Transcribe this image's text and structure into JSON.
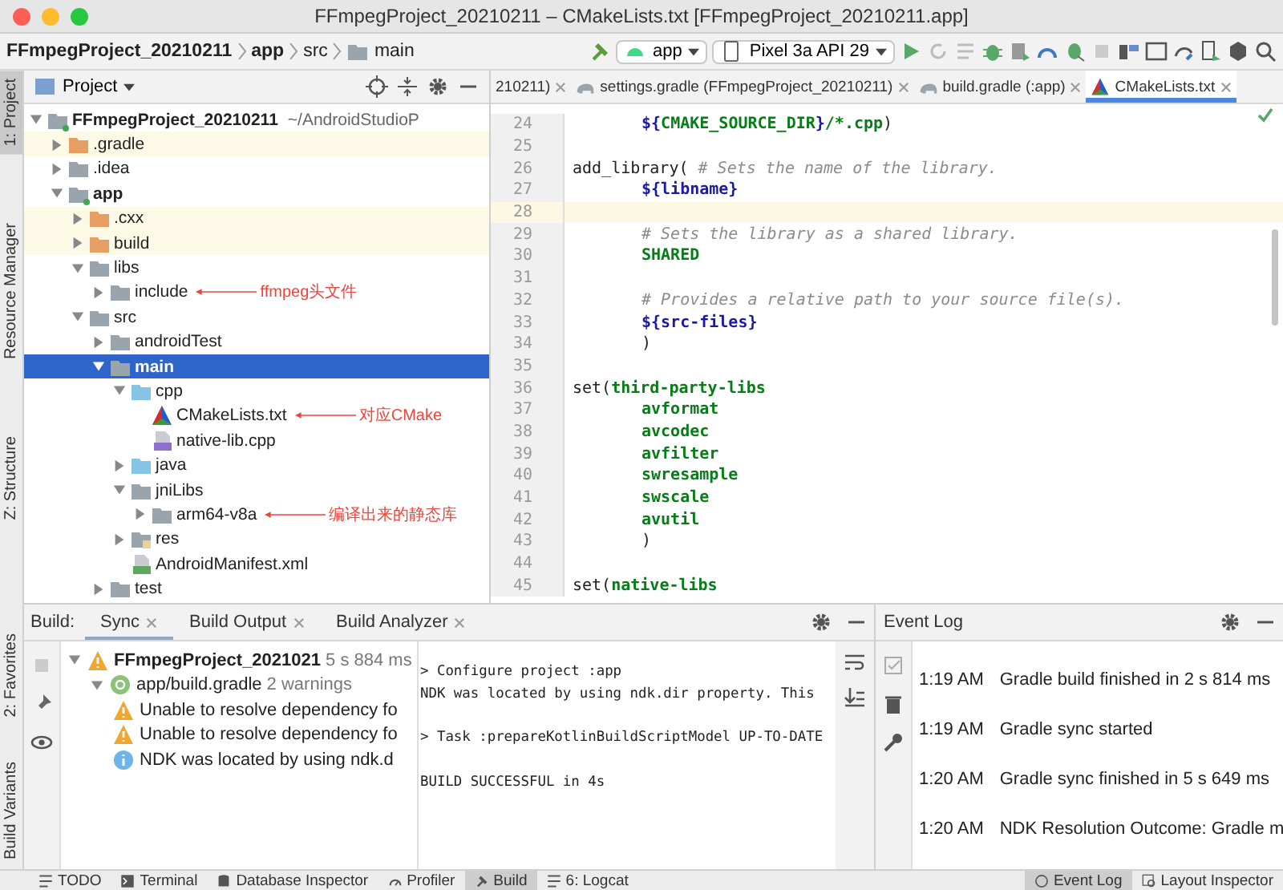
{
  "window": {
    "title": "FFmpegProject_20210211 – CMakeLists.txt [FFmpegProject_20210211.app]"
  },
  "breadcrumbs": [
    {
      "label": "FFmpegProject_20210211",
      "bold": true
    },
    {
      "label": "app",
      "bold": true
    },
    {
      "label": "src",
      "bold": false
    },
    {
      "label": "main",
      "bold": false
    }
  ],
  "run_config": {
    "label": "app"
  },
  "device": {
    "label": "Pixel 3a API 29"
  },
  "left_strip_top": [
    {
      "label": "1: Project",
      "selected": true
    },
    {
      "label": "Resource Manager",
      "selected": false
    },
    {
      "label": "Z: Structure",
      "selected": false
    }
  ],
  "left_strip_bottom": [
    {
      "label": "2: Favorites",
      "selected": false
    },
    {
      "label": "Build Variants",
      "selected": false
    }
  ],
  "project_panel": {
    "title": "Project",
    "tree": [
      {
        "label": "FFmpegProject_20210211",
        "path": "~/AndroidStudioP",
        "kind": "module",
        "bold": true,
        "expanded": true,
        "selected": false,
        "children": [
          {
            "label": ".gradle",
            "kind": "excluded",
            "expanded": false,
            "selected": false
          },
          {
            "label": ".idea",
            "kind": "folder",
            "expanded": false,
            "selected": false
          },
          {
            "label": "app",
            "kind": "module",
            "bold": true,
            "expanded": true,
            "selected": false,
            "children": [
              {
                "label": ".cxx",
                "kind": "excluded",
                "expanded": false,
                "selected": false
              },
              {
                "label": "build",
                "kind": "excluded",
                "expanded": false,
                "selected": false
              },
              {
                "label": "libs",
                "kind": "folder",
                "expanded": true,
                "selected": false,
                "children": [
                  {
                    "label": "include",
                    "kind": "folder",
                    "expanded": false,
                    "selected": false,
                    "note": "ffmpeg头文件"
                  }
                ]
              },
              {
                "label": "src",
                "kind": "folder",
                "expanded": true,
                "selected": false,
                "children": [
                  {
                    "label": "androidTest",
                    "kind": "folder",
                    "expanded": false,
                    "selected": false
                  },
                  {
                    "label": "main",
                    "kind": "folder",
                    "bold": true,
                    "expanded": true,
                    "selected": true,
                    "children": [
                      {
                        "label": "cpp",
                        "kind": "source",
                        "expanded": true,
                        "selected": false,
                        "children": [
                          {
                            "label": "CMakeLists.txt",
                            "kind": "cmake",
                            "selected": false,
                            "note": "对应CMake"
                          },
                          {
                            "label": "native-lib.cpp",
                            "kind": "cpp",
                            "selected": false
                          }
                        ]
                      },
                      {
                        "label": "java",
                        "kind": "source",
                        "expanded": false,
                        "selected": false
                      },
                      {
                        "label": "jniLibs",
                        "kind": "folder",
                        "expanded": true,
                        "selected": false,
                        "children": [
                          {
                            "label": "arm64-v8a",
                            "kind": "folder",
                            "expanded": false,
                            "selected": false,
                            "note": "编译出来的静态库"
                          }
                        ]
                      },
                      {
                        "label": "res",
                        "kind": "resources",
                        "expanded": false,
                        "selected": false
                      },
                      {
                        "label": "AndroidManifest.xml",
                        "kind": "manifest",
                        "selected": false
                      }
                    ]
                  },
                  {
                    "label": "test",
                    "kind": "folder",
                    "expanded": false,
                    "selected": false
                  }
                ]
              }
            ]
          }
        ]
      }
    ]
  },
  "editor_tabs": [
    {
      "label": "210211)",
      "kind": "text",
      "selected": false
    },
    {
      "label": "settings.gradle (FFmpegProject_20210211)",
      "kind": "gradle",
      "selected": false
    },
    {
      "label": "build.gradle (:app)",
      "kind": "gradle",
      "selected": false
    },
    {
      "label": "CMakeLists.txt",
      "kind": "cmake",
      "selected": true
    }
  ],
  "code_lines": [
    {
      "number": "24",
      "indented": true,
      "current": false,
      "segments": [
        {
          "text": "${",
          "kind": "var"
        },
        {
          "text": "CMAKE_SOURCE_DIR",
          "kind": "value"
        },
        {
          "text": "}",
          "kind": "var"
        },
        {
          "text": "/*.cpp",
          "kind": "value"
        },
        {
          "text": ")",
          "kind": "plain"
        }
      ]
    },
    {
      "number": "25",
      "current": false
    },
    {
      "number": "26",
      "indented": false,
      "current": false,
      "segments": [
        {
          "text": "add_library(",
          "kind": "plain"
        },
        {
          "text": " # Sets the name of the library.",
          "kind": "comment"
        }
      ]
    },
    {
      "number": "27",
      "indented": true,
      "current": false,
      "segments": [
        {
          "text": "${libname}",
          "kind": "var"
        }
      ]
    },
    {
      "number": "28",
      "current": true
    },
    {
      "number": "29",
      "indented": true,
      "current": false,
      "segments": [
        {
          "text": "# Sets the library as a shared library.",
          "kind": "comment"
        }
      ]
    },
    {
      "number": "30",
      "indented": true,
      "current": false,
      "segments": [
        {
          "text": "SHARED",
          "kind": "value"
        }
      ]
    },
    {
      "number": "31",
      "current": false
    },
    {
      "number": "32",
      "indented": true,
      "current": false,
      "segments": [
        {
          "text": "# Provides a relative path to your source file(s).",
          "kind": "comment"
        }
      ]
    },
    {
      "number": "33",
      "indented": true,
      "current": false,
      "segments": [
        {
          "text": "${src-files}",
          "kind": "var"
        }
      ]
    },
    {
      "number": "34",
      "indented": true,
      "current": false,
      "segments": [
        {
          "text": ")",
          "kind": "plain"
        }
      ]
    },
    {
      "number": "35",
      "current": false
    },
    {
      "number": "36",
      "indented": false,
      "current": false,
      "segments": [
        {
          "text": "set(",
          "kind": "plain"
        },
        {
          "text": "third-party-libs",
          "kind": "value"
        }
      ]
    },
    {
      "number": "37",
      "indented": true,
      "current": false,
      "segments": [
        {
          "text": "avformat",
          "kind": "value"
        }
      ]
    },
    {
      "number": "38",
      "indented": true,
      "current": false,
      "segments": [
        {
          "text": "avcodec",
          "kind": "value"
        }
      ]
    },
    {
      "number": "39",
      "indented": true,
      "current": false,
      "segments": [
        {
          "text": "avfilter",
          "kind": "value"
        }
      ]
    },
    {
      "number": "40",
      "indented": true,
      "current": false,
      "segments": [
        {
          "text": "swresample",
          "kind": "value"
        }
      ]
    },
    {
      "number": "41",
      "indented": true,
      "current": false,
      "segments": [
        {
          "text": "swscale",
          "kind": "value"
        }
      ]
    },
    {
      "number": "42",
      "indented": true,
      "current": false,
      "segments": [
        {
          "text": "avutil",
          "kind": "value"
        }
      ]
    },
    {
      "number": "43",
      "indented": true,
      "current": false,
      "segments": [
        {
          "text": ")",
          "kind": "plain"
        }
      ]
    },
    {
      "number": "44",
      "current": false
    },
    {
      "number": "45",
      "indented": false,
      "current": false,
      "segments": [
        {
          "text": "set(",
          "kind": "plain"
        },
        {
          "text": "native-libs",
          "kind": "value"
        }
      ]
    }
  ],
  "build_panel": {
    "label": "Build:",
    "tabs": [
      {
        "label": "Sync",
        "selected": true
      },
      {
        "label": "Build Output",
        "selected": false
      },
      {
        "label": "Build Analyzer",
        "selected": false
      }
    ],
    "tree": [
      {
        "kind": "warning",
        "text": "FFmpegProject_2021021",
        "detail": "5 s 884 ms",
        "bold": true,
        "expanded": true
      },
      {
        "kind": "gradle",
        "text": "app/build.gradle",
        "detail": "2 warnings",
        "bold": false,
        "expanded": true
      },
      {
        "kind": "warning",
        "text": "Unable to resolve dependency fo",
        "bold": false
      },
      {
        "kind": "warning",
        "text": "Unable to resolve dependency fo",
        "bold": false
      },
      {
        "kind": "info",
        "text": "NDK was located by using ndk.d",
        "bold": false
      }
    ],
    "console": [
      {
        "text": "> Configure project :app",
        "gap_before": false
      },
      {
        "text": "NDK was located by using ndk.dir property. This",
        "gap_before": false
      },
      {
        "text": "> Task :prepareKotlinBuildScriptModel UP-TO-DATE",
        "gap_before": true
      },
      {
        "text": "BUILD SUCCESSFUL in 4s",
        "gap_before": true
      }
    ]
  },
  "event_log": {
    "title": "Event Log",
    "entries": [
      {
        "time": "1:19 AM",
        "message": "Gradle build finished in 2 s 814 ms"
      },
      {
        "time": "1:19 AM",
        "message": "Gradle sync started"
      },
      {
        "time": "1:20 AM",
        "message": "Gradle sync finished in 5 s 649 ms"
      },
      {
        "time": "1:20 AM",
        "message": "NDK Resolution Outcome: Gradle m"
      }
    ]
  },
  "status_left": [
    {
      "label": "TODO",
      "kind": "list",
      "selected": false
    },
    {
      "label": "Terminal",
      "kind": "terminal",
      "selected": false
    },
    {
      "label": "Database Inspector",
      "kind": "database",
      "selected": false
    },
    {
      "label": "Profiler",
      "kind": "gauge",
      "selected": false
    },
    {
      "label": "Build",
      "kind": "hammer",
      "selected": true
    },
    {
      "label": "6: Logcat",
      "kind": "list",
      "selected": false
    }
  ],
  "status_right": [
    {
      "label": "Event Log",
      "kind": "bubble",
      "selected": true
    },
    {
      "label": "Layout Inspector",
      "kind": "inspector",
      "selected": false
    }
  ]
}
